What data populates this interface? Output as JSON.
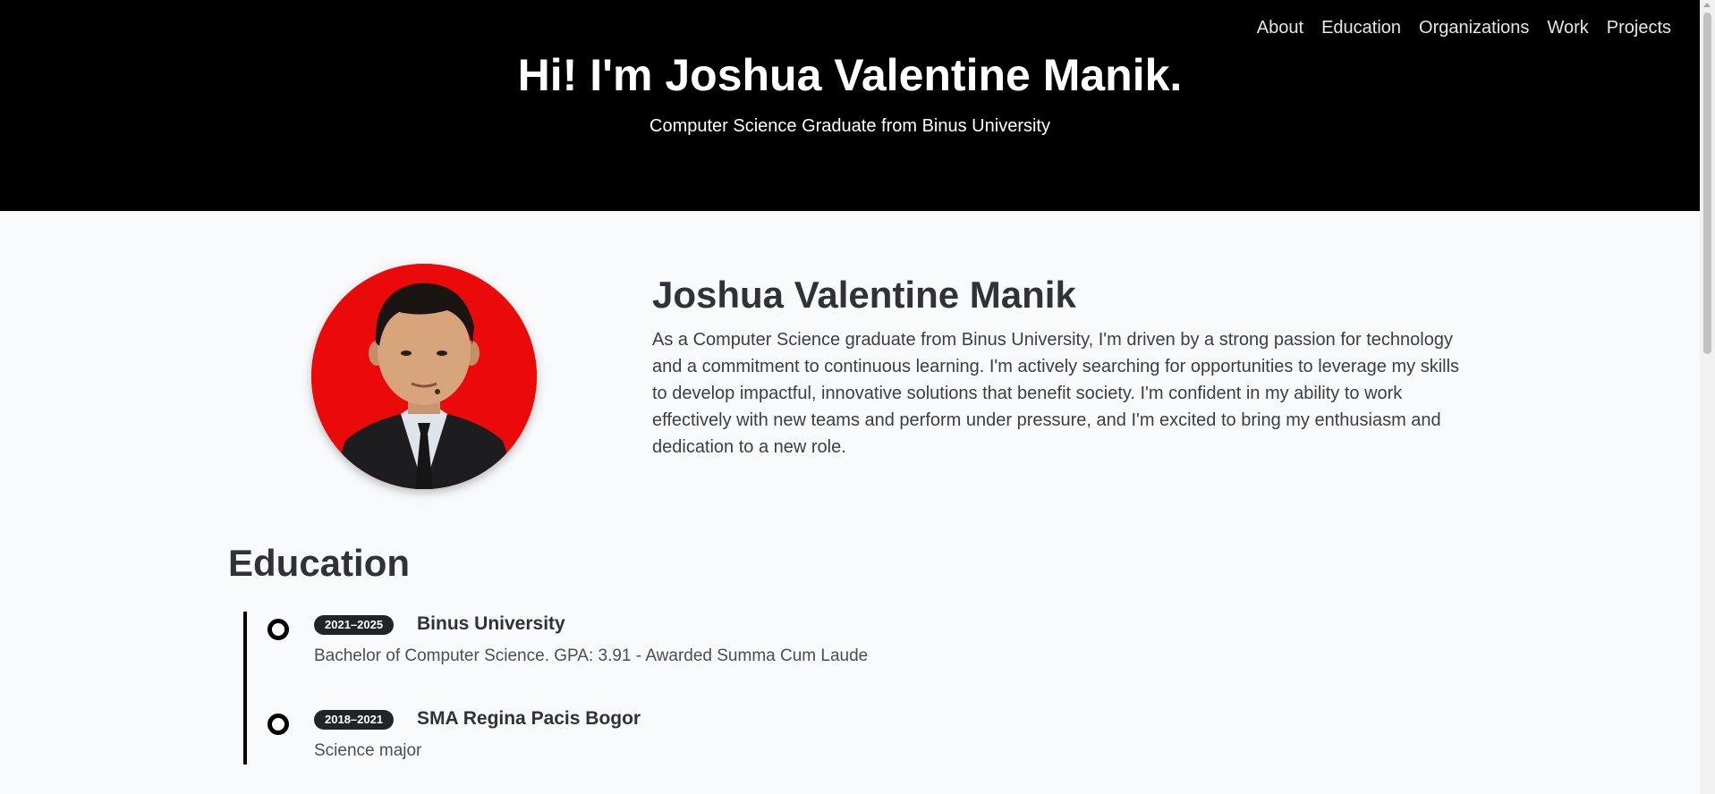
{
  "nav": {
    "items": [
      "About",
      "Education",
      "Organizations",
      "Work",
      "Projects"
    ]
  },
  "hero": {
    "title": "Hi! I'm Joshua Valentine Manik.",
    "subtitle": "Computer Science Graduate from Binus University"
  },
  "about": {
    "name": "Joshua Valentine Manik",
    "bio": "As a Computer Science graduate from Binus University, I'm driven by a strong passion for technology and a commitment to continuous learning. I'm actively searching for opportunities to leverage my skills to develop impactful, innovative solutions that benefit society. I'm confident in my ability to work effectively with new teams and perform under pressure, and I'm excited to bring my enthusiasm and dedication to a new role.",
    "photo": {
      "background_color": "#ea0a0a"
    }
  },
  "education": {
    "heading": "Education",
    "items": [
      {
        "years": "2021–2025",
        "school": "Binus University",
        "description": "Bachelor of Computer Science. GPA: 3.91 - Awarded Summa Cum Laude"
      },
      {
        "years": "2018–2021",
        "school": "SMA Regina Pacis Bogor",
        "description": "Science major"
      }
    ]
  },
  "colors": {
    "hero_background": "#000000",
    "page_background": "#f7f9fb",
    "badge_background": "#212529"
  }
}
